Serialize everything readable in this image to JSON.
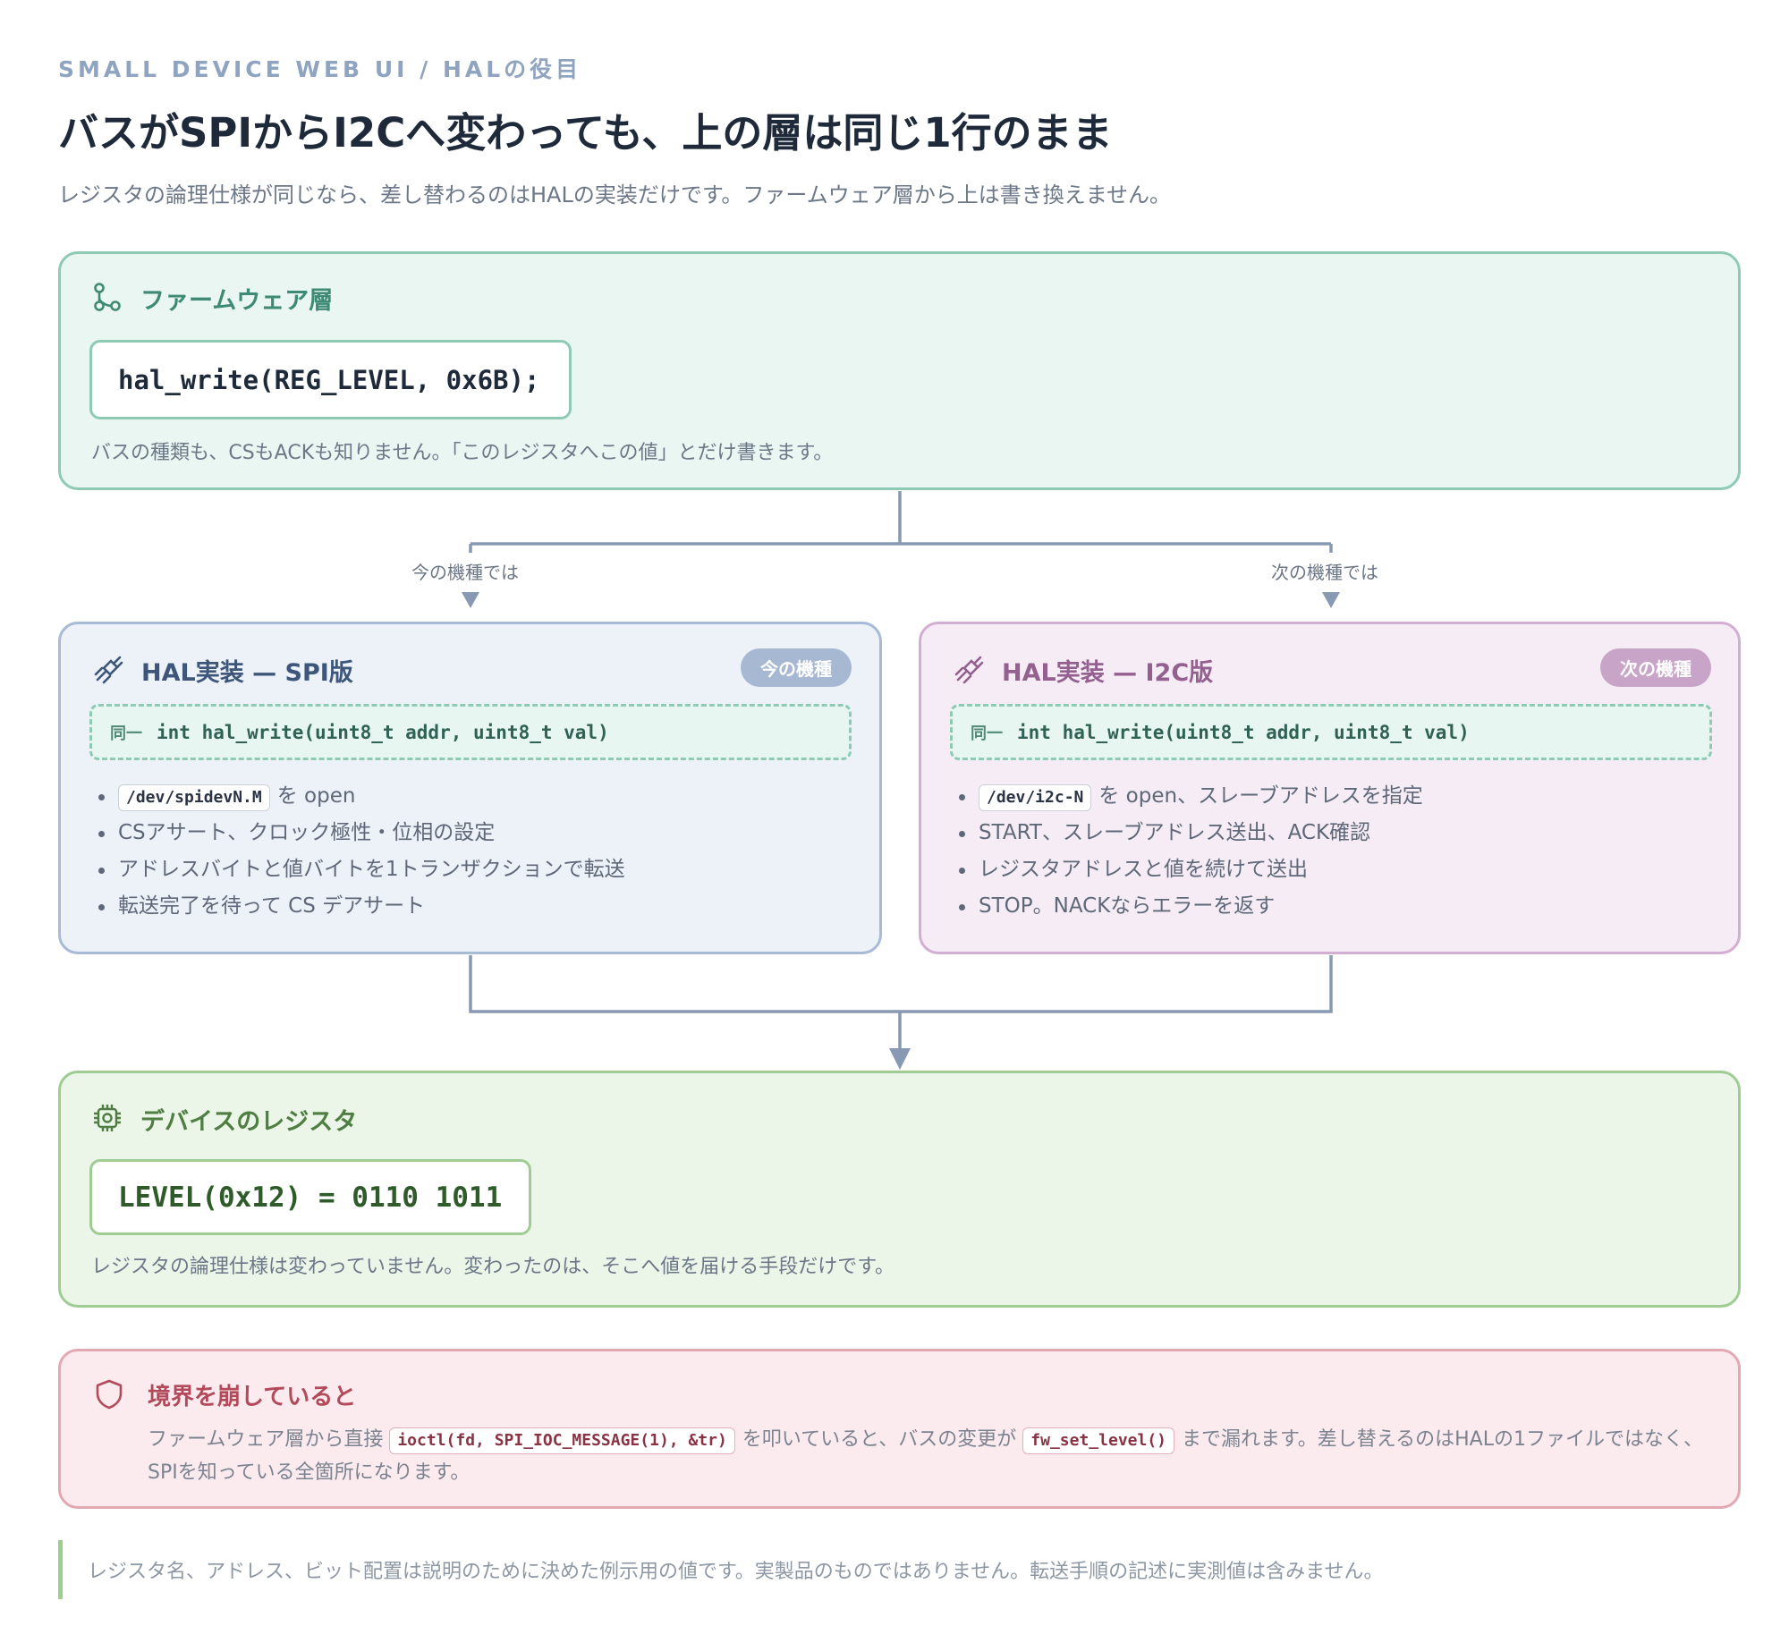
{
  "header": {
    "kicker": "SMALL DEVICE WEB UI / HALの役目",
    "title": "バスがSPIからI2Cへ変わっても、上の層は同じ1行のまま",
    "subtitle": "レジスタの論理仕様が同じなら、差し替わるのはHALの実装だけです。ファームウェア層から上は書き換えません。"
  },
  "firmware": {
    "icon": "git-branch-icon",
    "title": "ファームウェア層",
    "code": "hal_write(REG_LEVEL, 0x6B);",
    "note": "バスの種類も、CSもACKも知りません。「このレジスタへこの値」とだけ書きます。"
  },
  "branches": {
    "left_label": "今の機種では",
    "right_label": "次の機種では"
  },
  "spi": {
    "icon": "plug-icon",
    "title": "HAL実装 — SPI版",
    "badge": "今の機種",
    "same_label": "同一",
    "signature": "int hal_write(uint8_t addr, uint8_t val)",
    "item0_chip": "/dev/spidevN.M",
    "item0_text": "を open",
    "item1": "CSアサート、クロック極性・位相の設定",
    "item2": "アドレスバイトと値バイトを1トランザクションで転送",
    "item3": "転送完了を待って CS デアサート"
  },
  "i2c": {
    "icon": "plug-icon",
    "title": "HAL実装 — I2C版",
    "badge": "次の機種",
    "same_label": "同一",
    "signature": "int hal_write(uint8_t addr, uint8_t val)",
    "item0_chip": "/dev/i2c-N",
    "item0_text": "を open、スレーブアドレスを指定",
    "item1": "START、スレーブアドレス送出、ACK確認",
    "item2": "レジスタアドレスと値を続けて送出",
    "item3": "STOP。NACKならエラーを返す"
  },
  "device": {
    "icon": "chip-icon",
    "title": "デバイスのレジスタ",
    "code": "LEVEL(0x12) = 0110 1011",
    "note": "レジスタの論理仕様は変わっていません。変わったのは、そこへ値を届ける手段だけです。"
  },
  "warning": {
    "icon": "shield-icon",
    "title": "境界を崩していると",
    "text_a": "ファームウェア層から直接",
    "chip_a": "ioctl(fd, SPI_IOC_MESSAGE(1), &tr)",
    "text_b": "を叩いていると、バスの変更が",
    "chip_b": "fw_set_level()",
    "text_c": "まで漏れます。差し替えるのはHALの1ファイルではなく、SPIを知っている全箇所になります。"
  },
  "footnote": "レジスタ名、アドレス、ビット配置は説明のために決めた例示用の値です。実製品のものではありません。転送手順の記述に実測値は含みません。",
  "colors": {
    "firmware_accent": "#3f8a74",
    "spi_accent": "#3d5679",
    "i2c_accent": "#94608f",
    "device_accent": "#4f7e42",
    "warning_accent": "#b24a5c",
    "connector": "#8799b3"
  }
}
